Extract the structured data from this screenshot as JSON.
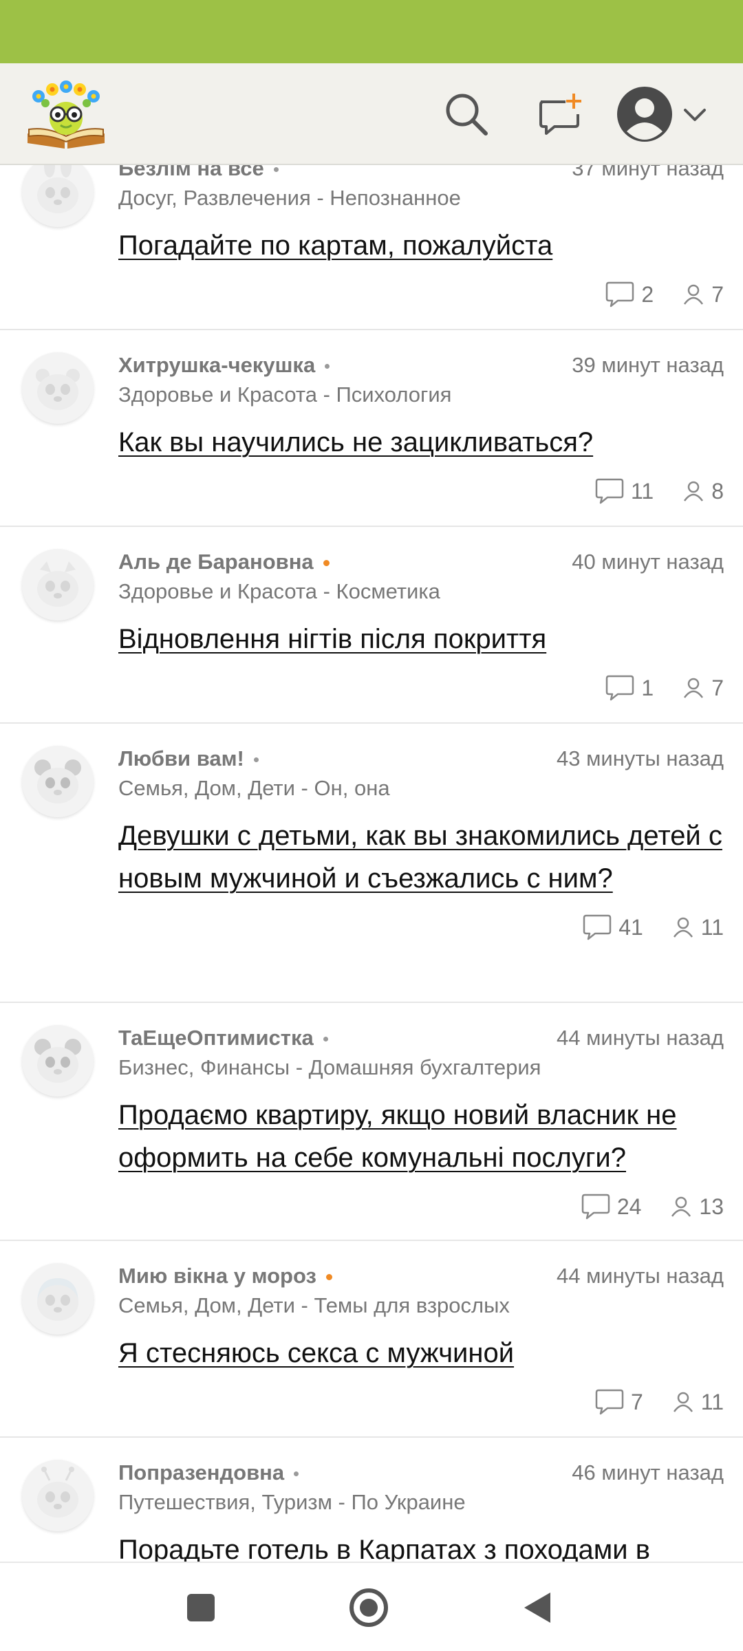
{
  "header": {
    "logo_icon": "flower-book-logo",
    "search_icon": "search-icon",
    "new_topic_icon": "new-topic-icon",
    "profile_icon": "user-avatar-icon",
    "dropdown_icon": "chevron-down-icon"
  },
  "posts": [
    {
      "author": "Безлім на все",
      "online": false,
      "time": "37 минут назад",
      "category": "Досуг, Развлечения - Непознанное",
      "title": "Погадайте по картам, пожалуйста",
      "comments": "2",
      "users": "7"
    },
    {
      "author": "Хитрушка-чекушка",
      "online": false,
      "time": "39 минут назад",
      "category": "Здоровье и Красота - Психология",
      "title": "Как вы научились не зацикливаться?",
      "comments": "11",
      "users": "8"
    },
    {
      "author": "Аль де Барановна",
      "online": true,
      "time": "40 минут назад",
      "category": "Здоровье и Красота - Косметика",
      "title": "Відновлення нігтів після покриття",
      "comments": "1",
      "users": "7"
    },
    {
      "author": "Любви вам!",
      "online": false,
      "time": "43 минуты назад",
      "category": "Семья, Дом, Дети - Он, она",
      "title": "Девушки с детьми, как вы знакомились детей с новым мужчиной и съезжались с ним?",
      "comments": "41",
      "users": "11"
    },
    {
      "author": "ТаЕщеОптимистка",
      "online": false,
      "time": "44 минуты назад",
      "category": "Бизнес, Финансы - Домашняя бухгалтерия",
      "title": "Продаємо квартиру, якщо новий власник не оформить на себе комунальні послуги?",
      "comments": "24",
      "users": "13"
    },
    {
      "author": "Мию вікна у мороз",
      "online": true,
      "time": "44 минуты назад",
      "category": "Семья, Дом, Дети - Темы для взрослых",
      "title": "Я стесняюсь секса с мужчиной",
      "comments": "7",
      "users": "11"
    },
    {
      "author": "Попразендовна",
      "online": false,
      "time": "46 минут назад",
      "category": "Путешествия, Туризм - По Украине",
      "title": "Порадьте готель в Карпатах з походами в",
      "comments": "",
      "users": ""
    }
  ],
  "nav": {
    "recents_icon": "recents-square-icon",
    "home_icon": "home-circle-icon",
    "back_icon": "back-triangle-icon"
  },
  "colors": {
    "status_bar": "#9dc146",
    "header_bg": "#f2f1ec",
    "online_dot": "#f08a24",
    "meta_text": "#777777"
  }
}
